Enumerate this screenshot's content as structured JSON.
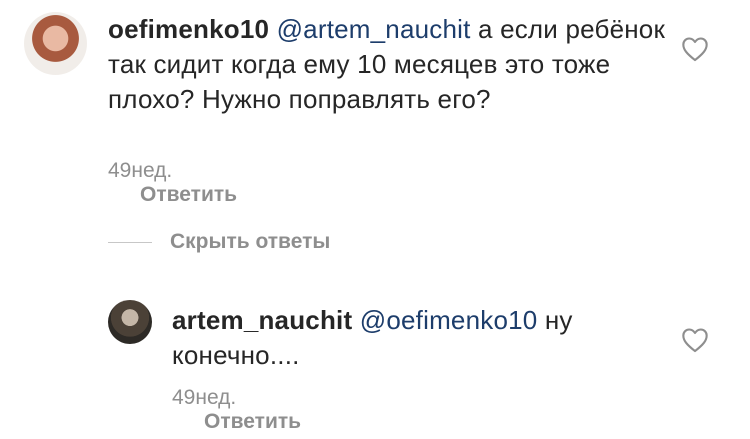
{
  "comments": [
    {
      "username": "oefimenko10",
      "mention": "@artem_nauchit",
      "text": " а если ребёнок так сидит когда ему 10 месяцев это тоже плохо? Нужно поправлять его?",
      "time": "49нед.",
      "reply_label": "Ответить",
      "like_icon": "heart-outline-icon"
    },
    {
      "username": "artem_nauchit",
      "mention": "@oefimenko10",
      "text": " ну конечно....",
      "time": "49нед.",
      "reply_label": "Ответить",
      "like_icon": "heart-outline-icon"
    }
  ],
  "hide_replies_label": "Скрыть ответы",
  "colors": {
    "text": "#262626",
    "mention": "#1d3d6b",
    "meta": "#8e8e8e",
    "divider": "#c7c7c7"
  }
}
